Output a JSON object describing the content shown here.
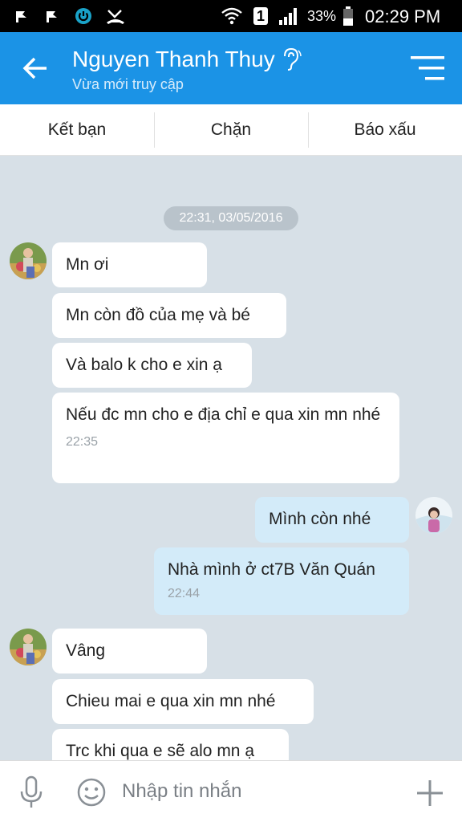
{
  "status_bar": {
    "battery": "33%",
    "time": "02:29 PM",
    "sim_slot": "1",
    "icons": [
      "notification-icon",
      "notification-icon",
      "power-icon",
      "missed-call-icon",
      "wifi-icon",
      "sim-icon",
      "signal-icon",
      "battery-icon"
    ]
  },
  "header": {
    "title": "Nguyen Thanh Thuy",
    "subtitle": "Vừa mới truy cập",
    "icons": [
      "back-arrow-icon",
      "ear-icon",
      "menu-icon"
    ],
    "accent_color": "#1b93e6"
  },
  "actions": [
    {
      "label": "Kết bạn"
    },
    {
      "label": "Chặn"
    },
    {
      "label": "Báo xấu"
    }
  ],
  "chat": {
    "date_badge": "22:31, 03/05/2016",
    "messages": [
      {
        "dir": "in",
        "text": "Mn ơi"
      },
      {
        "dir": "in",
        "text": "Mn còn đồ của mẹ và bé"
      },
      {
        "dir": "in",
        "text": "Và balo k cho e xin ạ"
      },
      {
        "dir": "in",
        "text": "Nếu đc mn cho e địa chỉ e qua xin mn nhé",
        "time": "22:35"
      },
      {
        "dir": "out",
        "text": "Mình còn nhé"
      },
      {
        "dir": "out",
        "text": "Nhà mình ở ct7B Văn Quán",
        "time": "22:44"
      },
      {
        "dir": "in",
        "text": "Vâng"
      },
      {
        "dir": "in",
        "text": "Chieu mai e qua xin mn nhé"
      },
      {
        "dir": "in",
        "text": "Trc khi qua e sẽ alo mn ạ"
      }
    ]
  },
  "input_bar": {
    "placeholder": "Nhập tin nhắn",
    "icons": [
      "microphone-icon",
      "emoji-icon",
      "plus-icon"
    ]
  }
}
